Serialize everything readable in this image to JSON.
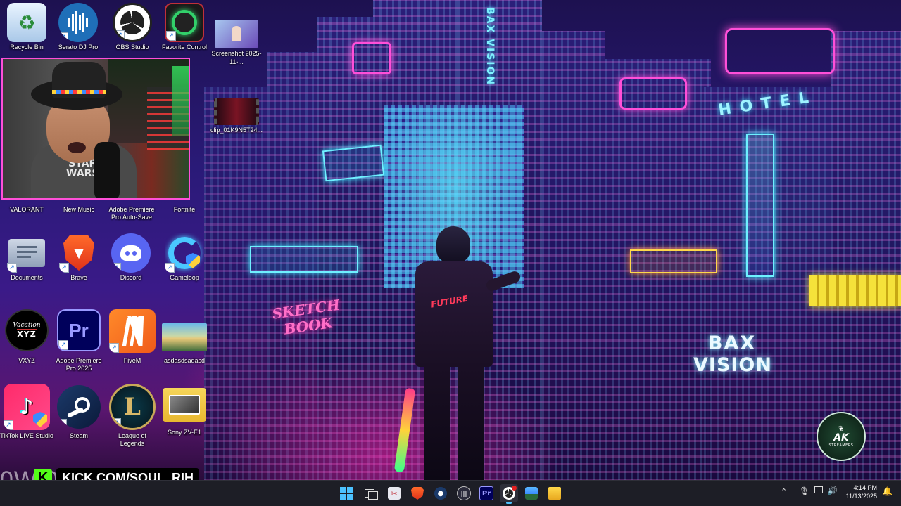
{
  "wallpaper": {
    "signs": {
      "vertical_tower": "BAX VISION",
      "bax_line1": "BAX",
      "bax_line2": "VISION",
      "hotel": "HOTEL",
      "sketch_line1": "SKETCH",
      "sketch_line2": "BOOK",
      "jacket": "FUTURE"
    },
    "stream_logo_text": "AK",
    "stream_logo_sub": "STREAMERS",
    "watermark_left": "0W 02",
    "accent_pink": "#ff3fb8",
    "accent_cyan": "#3ff0ff"
  },
  "desktop": {
    "top_row": [
      {
        "label": "Recycle Bin",
        "icon": "recycle-bin-icon"
      },
      {
        "label": "Serato DJ Pro",
        "icon": "serato-icon"
      },
      {
        "label": "OBS Studio",
        "icon": "obs-icon"
      },
      {
        "label": "Favorite Control",
        "icon": "favorite-control-icon"
      },
      {
        "label": "Screenshot 2025-11-...",
        "icon": "screenshot-thumbnail"
      }
    ],
    "clip": {
      "label": "clip_01K9N5T24...",
      "icon": "video-thumbnail"
    },
    "row2": [
      {
        "label": "VALORANT"
      },
      {
        "label": "New Music"
      },
      {
        "label": "Adobe Premiere Pro Auto-Save"
      },
      {
        "label": "Fortnite"
      }
    ],
    "row3": [
      {
        "label": "Documents",
        "icon": "folder-icon"
      },
      {
        "label": "Brave",
        "icon": "brave-icon"
      },
      {
        "label": "Discord",
        "icon": "discord-icon"
      },
      {
        "label": "Gameloop",
        "icon": "gameloop-icon"
      }
    ],
    "row4": [
      {
        "label": "VXYZ",
        "icon": "vacation-xyz-icon",
        "badge_line1": "Vacation",
        "badge_line2": "XYZ"
      },
      {
        "label": "Adobe Premiere Pro 2025",
        "icon": "premiere-pro-icon",
        "glyph": "Pr"
      },
      {
        "label": "FiveM",
        "icon": "fivem-icon"
      },
      {
        "label": "asdasdsadasd",
        "icon": "image-thumbnail"
      }
    ],
    "row5": [
      {
        "label": "TikTok LIVE Studio",
        "icon": "tiktok-icon"
      },
      {
        "label": "Steam",
        "icon": "steam-icon"
      },
      {
        "label": "League of Legends",
        "icon": "league-icon",
        "glyph": "L"
      },
      {
        "label": "Sony ZV-E1",
        "icon": "folder-icon"
      }
    ]
  },
  "webcam": {
    "shirt_text_line1": "STAR",
    "shirt_text_line2": "WARS"
  },
  "kick_banner": {
    "label": "KICK.COM/SOUL_RIH",
    "logo": "K"
  },
  "taskbar": {
    "apps": [
      {
        "name": "start",
        "icon": "windows-start-icon"
      },
      {
        "name": "task-view",
        "icon": "task-view-icon"
      },
      {
        "name": "snipping",
        "icon": "snipping-tool-icon"
      },
      {
        "name": "brave",
        "icon": "brave-icon"
      },
      {
        "name": "steam",
        "icon": "steam-icon"
      },
      {
        "name": "audio",
        "icon": "audio-app-icon"
      },
      {
        "name": "premiere",
        "icon": "premiere-pro-icon",
        "glyph": "Pr"
      },
      {
        "name": "obs",
        "icon": "obs-icon"
      },
      {
        "name": "photos",
        "icon": "photos-icon"
      },
      {
        "name": "explorer",
        "icon": "file-explorer-icon"
      }
    ],
    "tray": {
      "time": "4:14 PM",
      "date": "11/13/2025"
    }
  }
}
